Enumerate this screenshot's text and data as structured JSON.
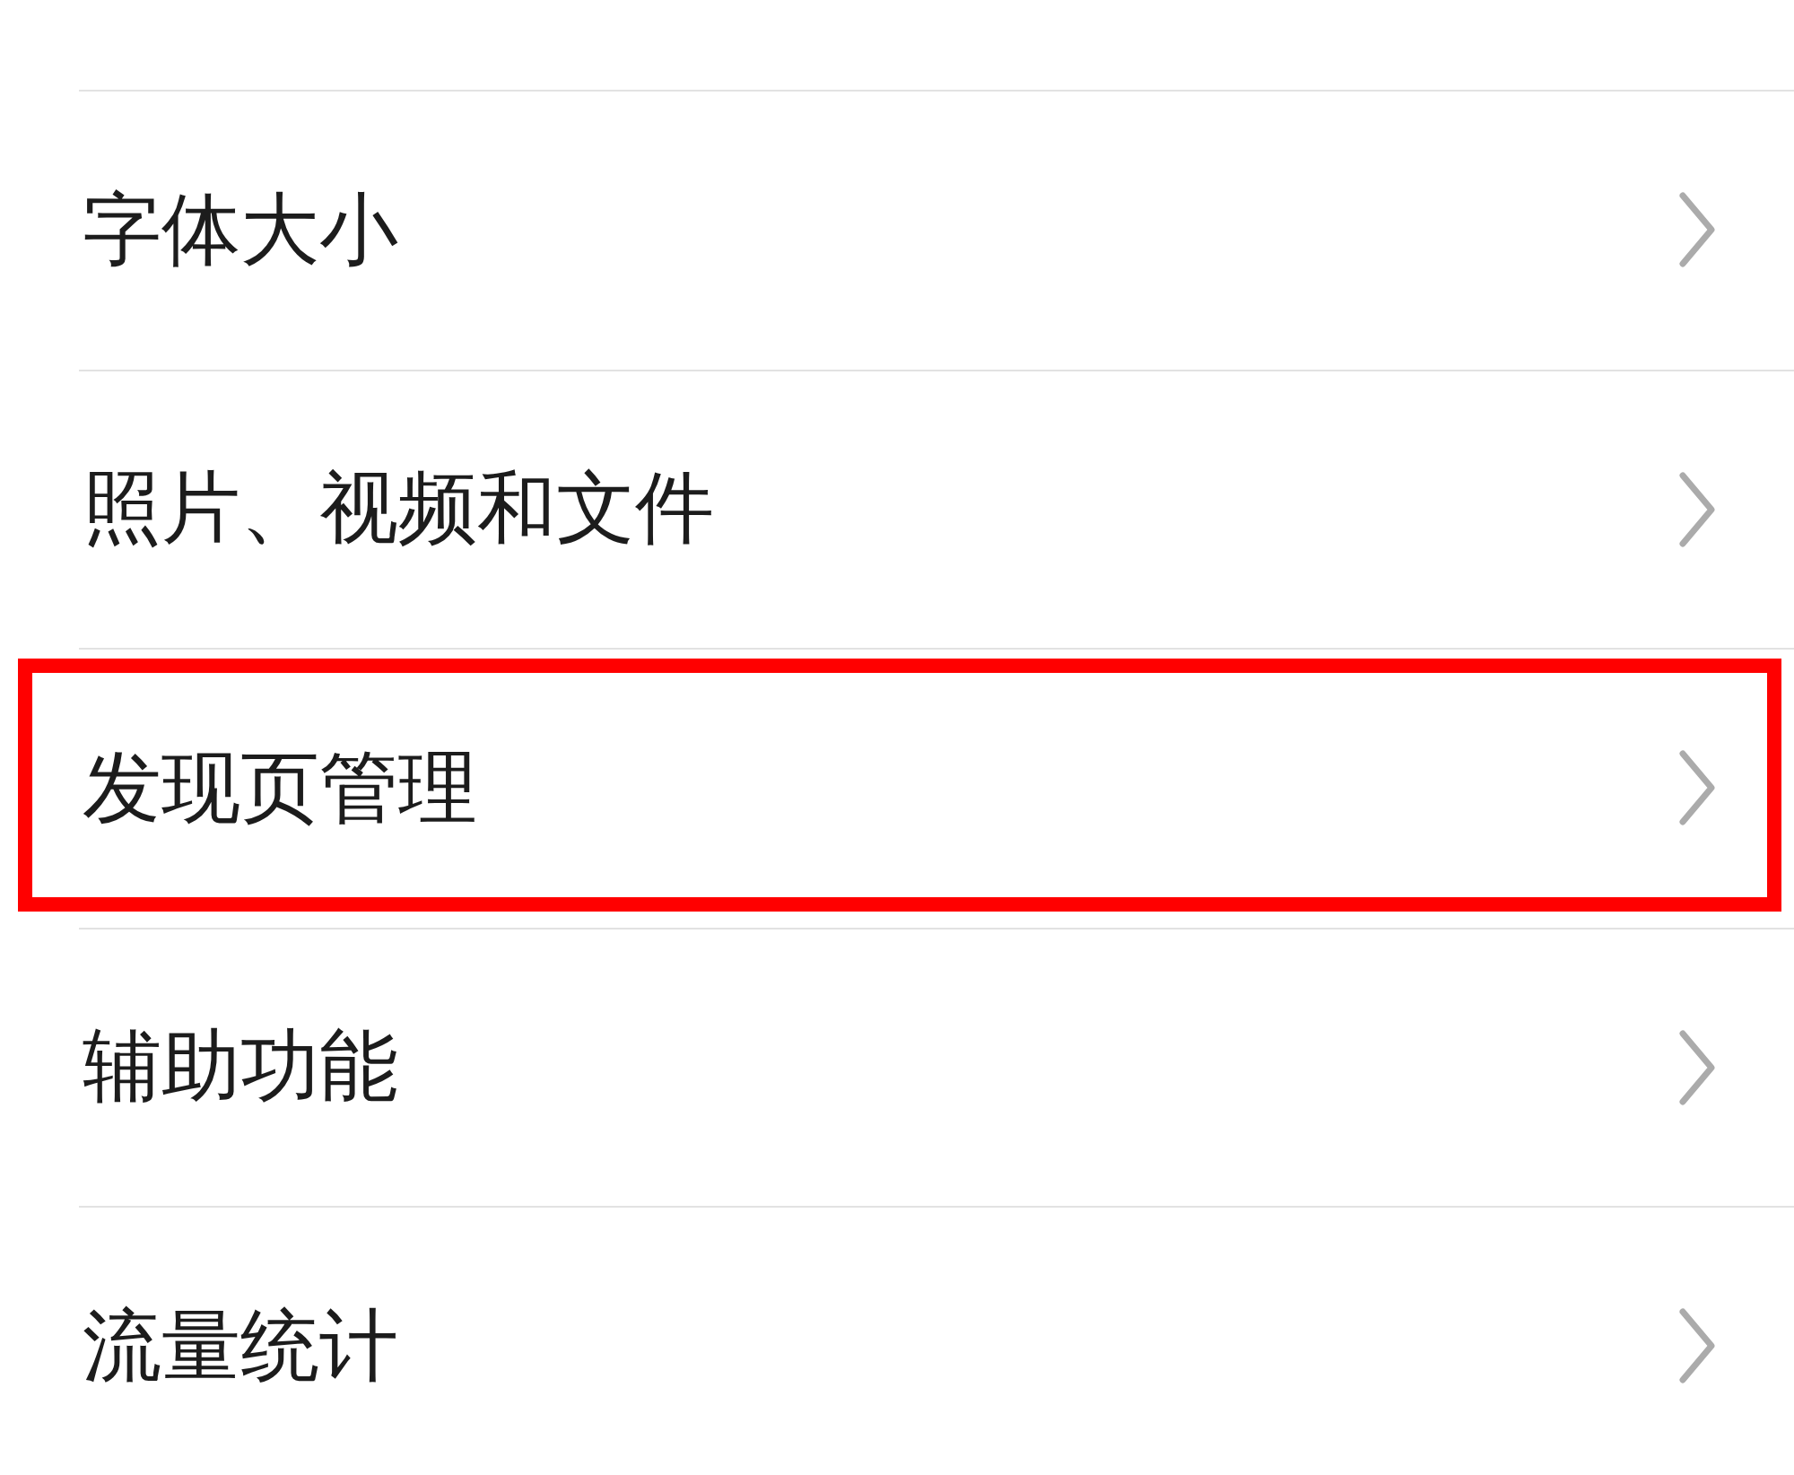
{
  "items": [
    {
      "label": "字体大小",
      "highlighted": false
    },
    {
      "label": "照片、视频和文件",
      "highlighted": false
    },
    {
      "label": "发现页管理",
      "highlighted": true
    },
    {
      "label": "辅助功能",
      "highlighted": false
    },
    {
      "label": "流量统计",
      "highlighted": false
    }
  ]
}
